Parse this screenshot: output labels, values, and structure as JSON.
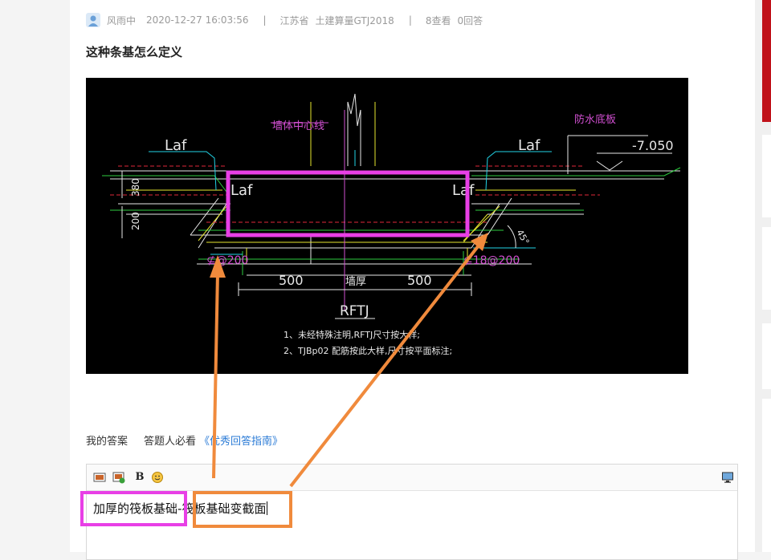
{
  "question": {
    "user": "风雨中",
    "datetime": "2020-12-27 16:03:56",
    "sep1": "|",
    "region": "江苏省",
    "software": "土建算量GTJ2018",
    "sep2": "|",
    "views": "8查看",
    "answers": "0回答",
    "title": "这种条基怎么定义"
  },
  "drawing": {
    "wall_center_line": "墙体中心线",
    "waterproof_slab": "防水底板",
    "elevation": "-7.050",
    "laf": "Laf",
    "dim_380": "380",
    "dim_200": "200",
    "rebar_left": "⊈@200",
    "rebar_right": "⊈18@200",
    "dim_500_left": "500",
    "wall_thickness": "墙厚",
    "dim_500_right": "500",
    "angle": "45°",
    "section_name": "RFTJ",
    "note1": "1、未经特殊注明,RFTJ尺寸按大样;",
    "note2": "2、TJBp02 配筋按此大样,尺寸按平面标注;"
  },
  "answer_tabs": {
    "my_answer": "我的答案",
    "must_read": "答题人必看",
    "guide_link": "《优秀回答指南》"
  },
  "editor": {
    "toolbar": {
      "image_icon": "image-icon",
      "insert_image_icon": "insert-image-icon",
      "bold": "B",
      "emoji_icon": "smiley-icon",
      "fullscreen_icon": "monitor-icon"
    },
    "text_part1": "加厚的筏板基础",
    "text_sep": "-",
    "text_part2": "筏板基础变截面"
  },
  "colors": {
    "magenta_box": "#e83fe6",
    "orange_box": "#f08a3c",
    "link": "#2b7bd6",
    "sidebar_accent": "#c0121a"
  }
}
